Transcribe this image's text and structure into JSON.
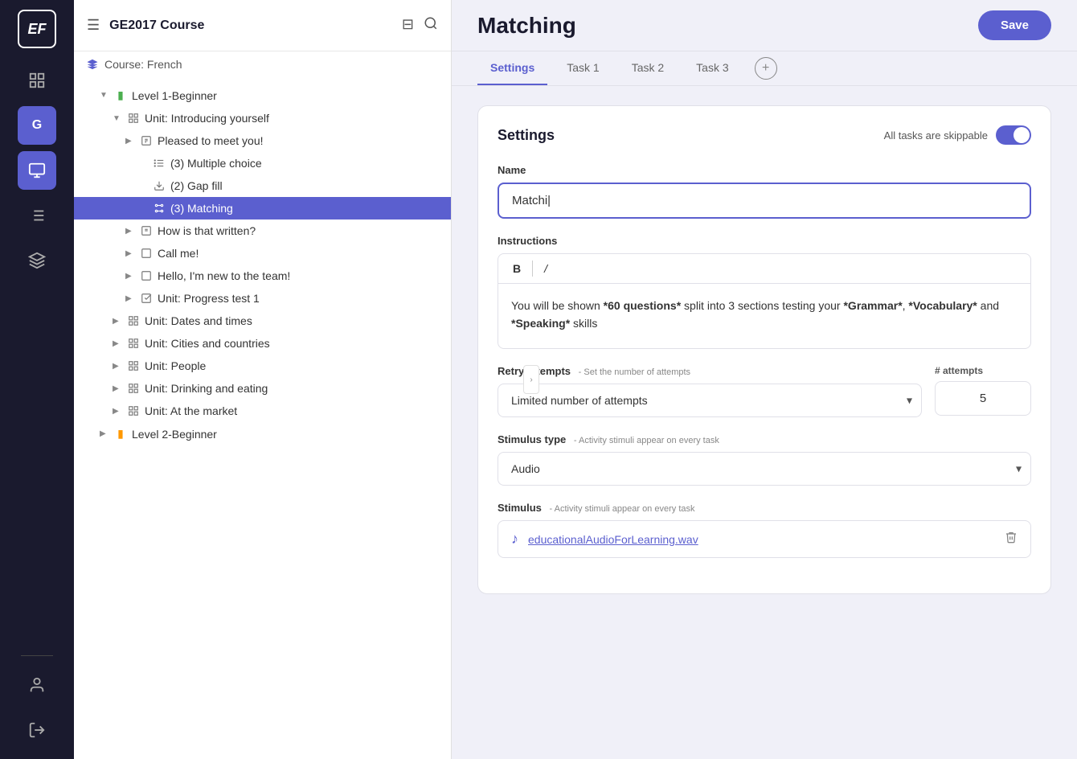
{
  "app": {
    "logo": "EF",
    "course_label": "Course: French"
  },
  "header": {
    "title": "GE2017 Course"
  },
  "main": {
    "title": "Matching",
    "save_label": "Save"
  },
  "tabs": [
    {
      "id": "settings",
      "label": "Settings",
      "active": true
    },
    {
      "id": "task1",
      "label": "Task 1",
      "active": false
    },
    {
      "id": "task2",
      "label": "Task 2",
      "active": false
    },
    {
      "id": "task3",
      "label": "Task 3",
      "active": false
    }
  ],
  "settings": {
    "title": "Settings",
    "skippable_label": "All tasks are skippable",
    "name_label": "Name",
    "name_value": "Matchi|",
    "instructions_label": "Instructions",
    "instructions_bold": "B",
    "instructions_italic": "/",
    "instructions_text": "You will be shown *60 questions* split into 3 sections testing your *Grammar*, *Vocabulary* and *Speaking* skills",
    "retry_label": "Retry attempts",
    "retry_sublabel": "- Set the number of attempts",
    "retry_option": "Limited number of attempts",
    "attempts_label": "# attempts",
    "attempts_value": "5",
    "stimulus_type_label": "Stimulus type",
    "stimulus_type_sublabel": "- Activity stimuli appear on every task",
    "stimulus_type_value": "Audio",
    "stimulus_label": "Stimulus",
    "stimulus_sublabel": "- Activity stimuli appear on every task",
    "stimulus_filename": "educationalAudioForLearning.wav"
  },
  "tree": [
    {
      "id": "level1",
      "label": "Level 1-Beginner",
      "indent": 1,
      "type": "level",
      "arrow": "▼",
      "icon": "level"
    },
    {
      "id": "unit-intro",
      "label": "Unit: Introducing yourself",
      "indent": 2,
      "type": "unit",
      "arrow": "▼"
    },
    {
      "id": "pleased",
      "label": "Pleased to meet you!",
      "indent": 3,
      "type": "lesson",
      "arrow": "▶"
    },
    {
      "id": "multiple",
      "label": "(3) Multiple choice",
      "indent": 4,
      "type": "activity",
      "arrow": ""
    },
    {
      "id": "gap",
      "label": "(2) Gap fill",
      "indent": 4,
      "type": "activity",
      "arrow": ""
    },
    {
      "id": "matching",
      "label": "(3) Matching",
      "indent": 4,
      "type": "matching",
      "arrow": "",
      "selected": true
    },
    {
      "id": "how-written",
      "label": "How is that written?",
      "indent": 3,
      "type": "lesson",
      "arrow": "▶"
    },
    {
      "id": "call-me",
      "label": "Call me!",
      "indent": 3,
      "type": "lesson",
      "arrow": "▶"
    },
    {
      "id": "hello-new",
      "label": "Hello, I'm new to the team!",
      "indent": 3,
      "type": "lesson",
      "arrow": "▶"
    },
    {
      "id": "progress1",
      "label": "Unit: Progress test 1",
      "indent": 3,
      "type": "progress",
      "arrow": "▶"
    },
    {
      "id": "unit-dates",
      "label": "Unit: Dates and times",
      "indent": 2,
      "type": "unit",
      "arrow": "▶"
    },
    {
      "id": "unit-cities",
      "label": "Unit: Cities and countries",
      "indent": 2,
      "type": "unit",
      "arrow": "▶"
    },
    {
      "id": "unit-people",
      "label": "Unit: People",
      "indent": 2,
      "type": "unit",
      "arrow": "▶"
    },
    {
      "id": "unit-drinking",
      "label": "Unit: Drinking and eating",
      "indent": 2,
      "type": "unit",
      "arrow": "▶"
    },
    {
      "id": "unit-market",
      "label": "Unit: At the market",
      "indent": 2,
      "type": "unit",
      "arrow": "▶"
    },
    {
      "id": "level2",
      "label": "Level 2-Beginner",
      "indent": 1,
      "type": "level2",
      "arrow": "▶",
      "icon": "level2"
    }
  ]
}
